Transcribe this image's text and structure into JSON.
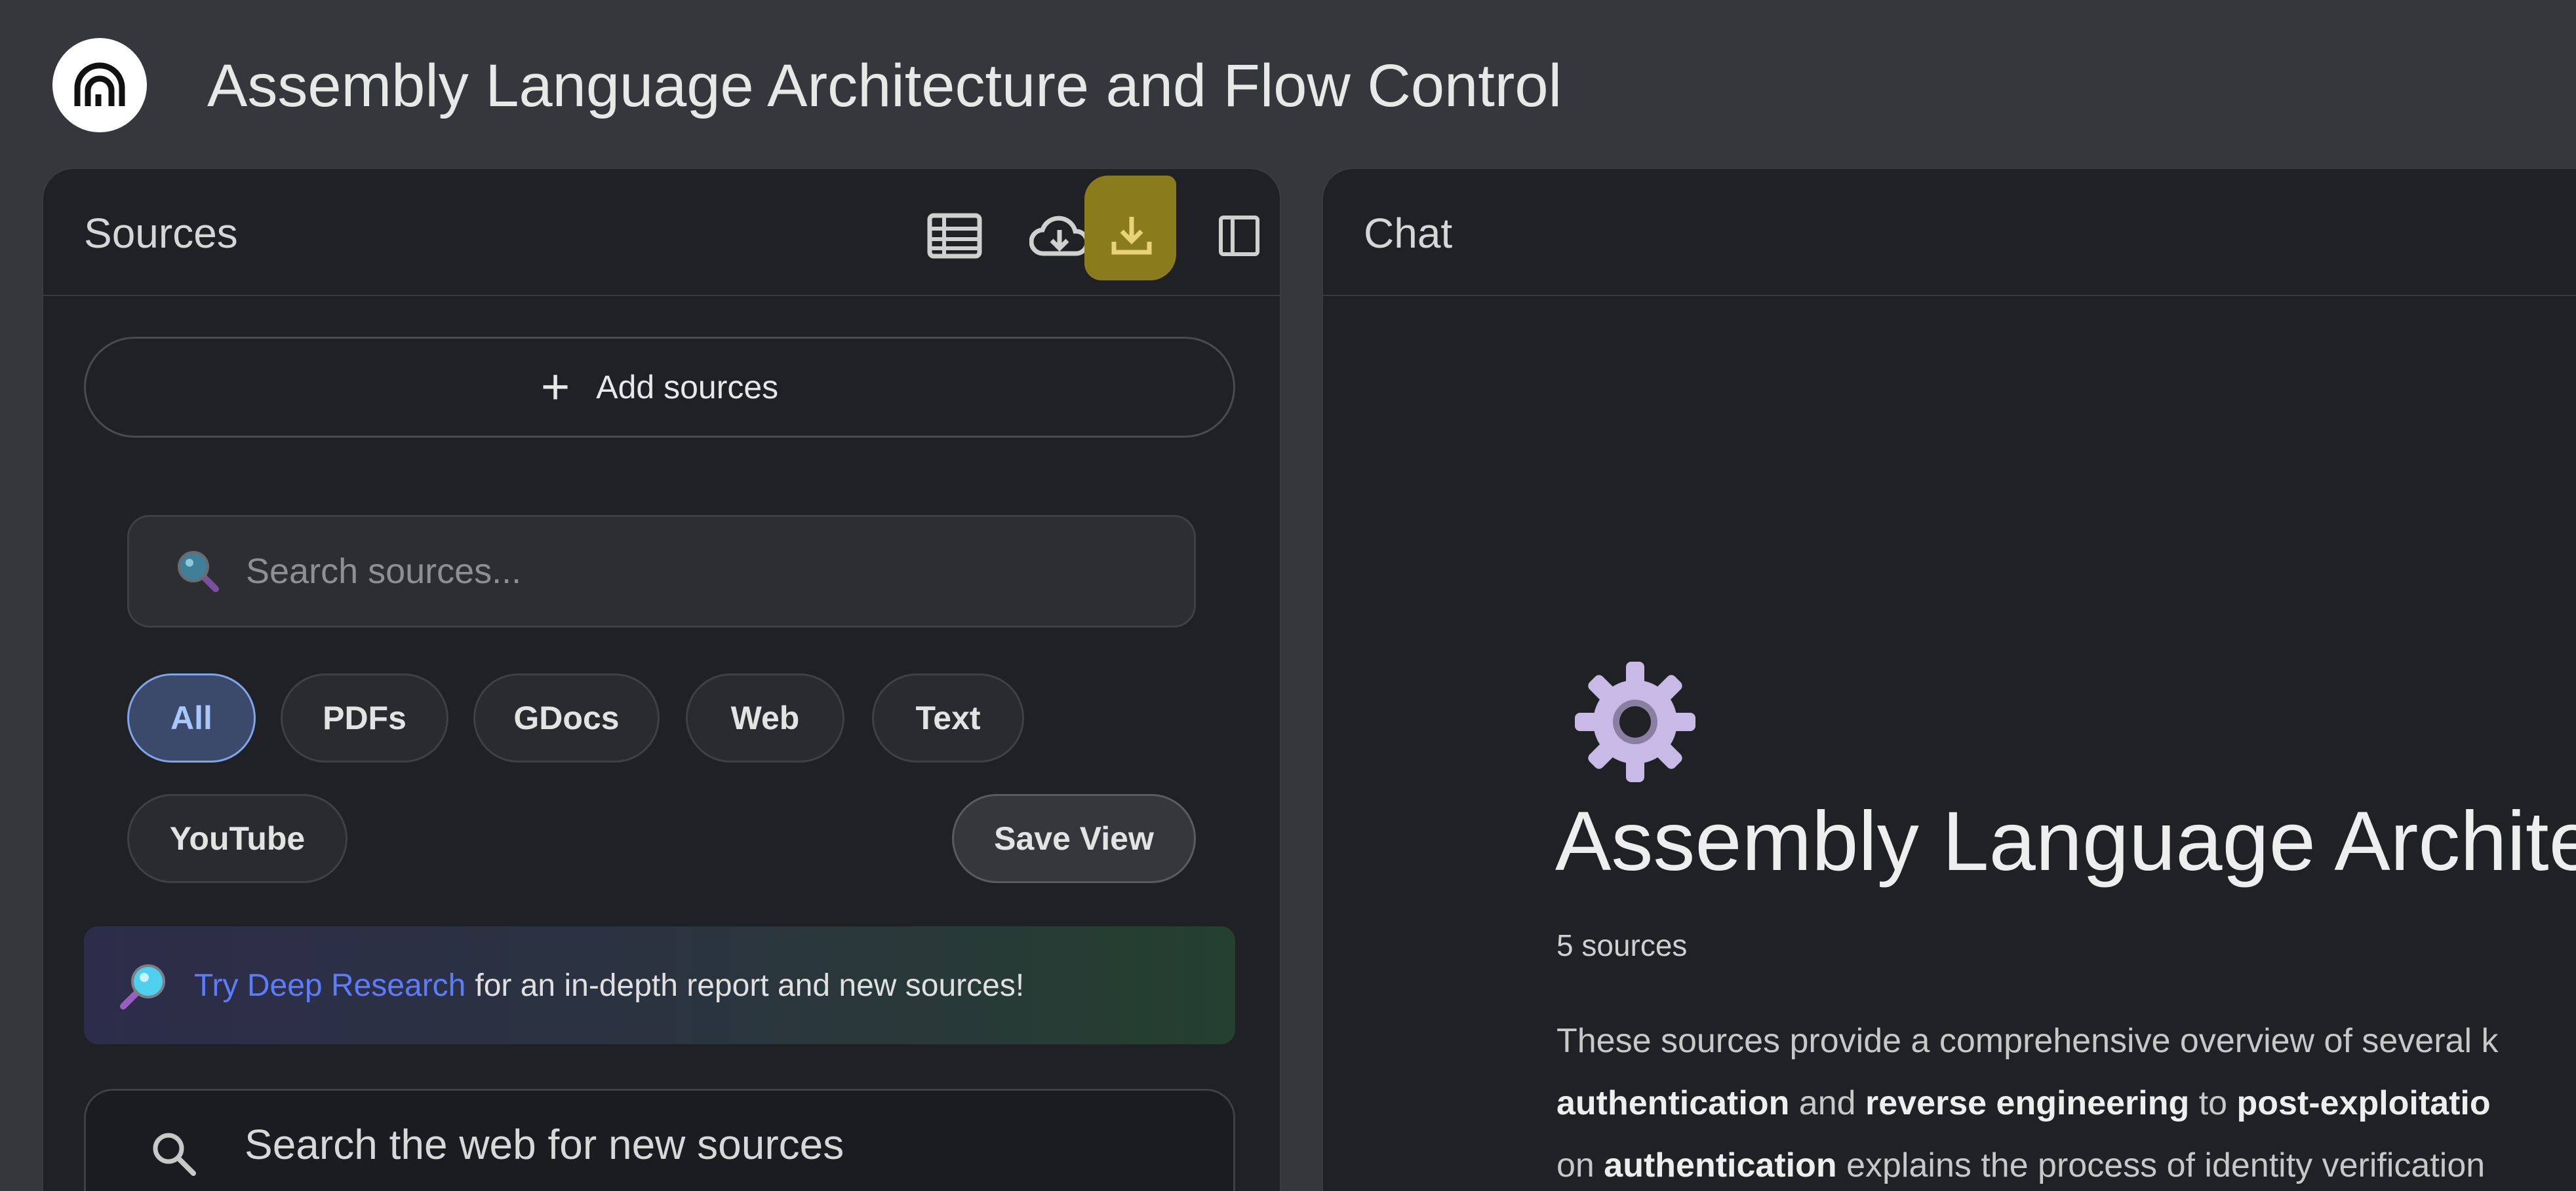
{
  "app": {
    "title": "Assembly Language Architecture and Flow Control"
  },
  "sources": {
    "title": "Sources",
    "icons": [
      "table-icon",
      "cloud-download-icon",
      "download-icon",
      "sidebar-toggle-icon"
    ],
    "add_sources_label": "Add sources",
    "search_placeholder": "Search sources...",
    "filters": [
      "All",
      "PDFs",
      "GDocs",
      "Web",
      "Text",
      "YouTube"
    ],
    "active_filter": "All",
    "save_view_label": "Save View",
    "deep_research": {
      "link": "Try Deep Research",
      "text": "for an in-depth report and new sources!"
    },
    "web_search_placeholder": "Search the web for new sources"
  },
  "chat": {
    "title": "Chat",
    "heading": "Assembly Language Archite",
    "source_count": "5 sources",
    "summary": {
      "l1": "These sources provide a comprehensive overview of several k",
      "l2_b1": "authentication",
      "l2_t1": "and",
      "l2_b2": "reverse engineering",
      "l2_t2": "to",
      "l2_b3": "post-exploitatio",
      "l3_t1": "on",
      "l3_b1": "authentication",
      "l3_t2": "explains the process of identity verification"
    }
  },
  "colors": {
    "background": "#36373c",
    "panel": "#202124",
    "active_chip": "#a8c7fa",
    "deep_research_link": "#5c7cff",
    "highlight": "#8a7b1c"
  }
}
